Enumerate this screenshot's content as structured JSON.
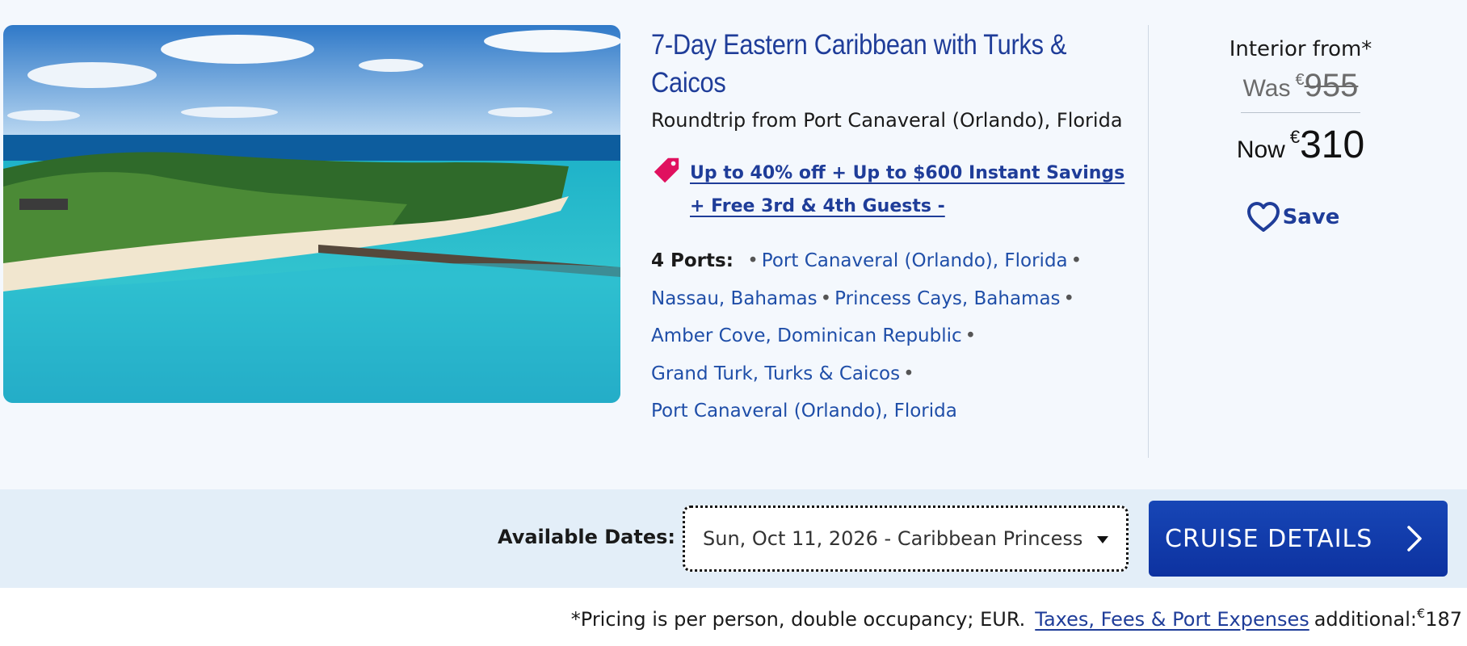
{
  "cruise": {
    "title": "7-Day Eastern Caribbean with Turks & Caicos",
    "itinerary": "Roundtrip from Port Canaveral (Orlando), Florida",
    "promo": "Up to 40% off + Up to $600 Instant Savings + Free 3rd & 4th Guests -",
    "ports_label": "4 Ports:",
    "ports": [
      "Port Canaveral (Orlando), Florida",
      "Nassau, Bahamas",
      "Princess Cays, Bahamas",
      "Amber Cove, Dominican Republic",
      "Grand Turk, Turks & Caicos",
      "Port Canaveral (Orlando), Florida"
    ],
    "bullet": "•"
  },
  "pricing": {
    "label": "Interior from*",
    "was_label": "Was",
    "was_currency": "€",
    "was_amount": "955",
    "now_label": "Now",
    "now_currency": "€",
    "now_amount": "310",
    "save_label": "Save"
  },
  "dates": {
    "label": "Available Dates:",
    "selected": "Sun, Oct 11, 2026 - Caribbean Princess"
  },
  "actions": {
    "details_label": "CRUISE DETAILS"
  },
  "footnote": {
    "text": "*Pricing is per person, double occupancy; EUR.",
    "link": "Taxes, Fees & Port Expenses",
    "suffix": "additional:",
    "currency": "€",
    "amount": "187"
  },
  "colors": {
    "brand_blue": "#1f3d99",
    "button_blue": "#1746b6",
    "promo_pink": "#e0115f"
  },
  "icons": {
    "promo": "price-tag-icon",
    "save": "heart-outline-icon",
    "details": "chevron-right-icon",
    "dates": "caret-down-icon"
  }
}
